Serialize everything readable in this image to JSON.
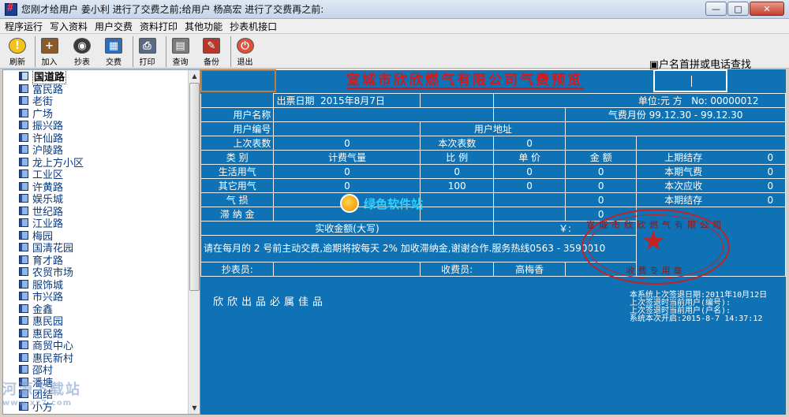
{
  "window": {
    "title": "您刚才给用户 姜小利 进行了交费之前;给用户 杨高宏 进行了交费再之前:",
    "buttons": [
      "—",
      "□",
      "✕"
    ]
  },
  "menu": [
    "程序运行",
    "写入资料",
    "用户交费",
    "资料打印",
    "其他功能",
    "抄表机接口"
  ],
  "toolbar": [
    {
      "label": "刷新",
      "icon": "lightbulb-icon",
      "color": "#f3c21b"
    },
    {
      "label": "加入",
      "icon": "add-record-icon",
      "color": "#8a5a2a"
    },
    {
      "label": "抄表",
      "icon": "meter-icon",
      "color": "#3a3a3a"
    },
    {
      "label": "交费",
      "icon": "calculator-icon",
      "color": "#2c6fb8"
    },
    {
      "label": "打印",
      "icon": "printer-icon",
      "color": "#596a85"
    },
    {
      "label": "查询",
      "icon": "query-icon",
      "color": "#7c7c7c"
    },
    {
      "label": "备份",
      "icon": "backup-icon",
      "color": "#b8372d"
    },
    {
      "label": "退出",
      "icon": "exit-icon",
      "color": "#e0513a"
    }
  ],
  "search_option": "▣户名首拼或电话查找",
  "tree": {
    "selected": "国道路",
    "items": [
      "国道路",
      "富民路",
      "老街",
      "广场",
      "振兴路",
      "许仙路",
      "沪陵路",
      "龙上方小区",
      "工业区",
      "许黄路",
      "娱乐城",
      "世纪路",
      "江业路",
      "梅园",
      "国清花园",
      "育才路",
      "农贸市场",
      "服饰城",
      "市兴路",
      "金鑫",
      "惠民园",
      "惠民路",
      "商贸中心",
      "惠民新村",
      "邵村",
      "潘塘",
      "团结",
      "小方"
    ]
  },
  "receipt": {
    "title": "宣城市欣欣燃气有限公司气费预览",
    "date_label": "出票日期",
    "date_value": "2015年8月7日",
    "unit_label": "单位:元 方",
    "no_label": "No:",
    "no_value": "00000012",
    "user_name_label": "用户名称",
    "period_label": "气费月份",
    "period_value": "99.12.30 - 99.12.30",
    "user_code_label": "用户编号",
    "address_label": "用户地址",
    "last_reading_label": "上次表数",
    "last_reading_value": "0",
    "this_reading_label": "本次表数",
    "this_reading_value": "0",
    "headers": [
      "类    别",
      "计费气量",
      "比    例",
      "单    价",
      "金    额"
    ],
    "rows": [
      {
        "type": "生活用气",
        "qty": "0",
        "ratio": "0",
        "price": "0",
        "amount": "0",
        "side_label": "上期结存",
        "side_value": "0"
      },
      {
        "type": "其它用气",
        "qty": "0",
        "ratio": "100",
        "price": "0",
        "amount": "0",
        "side_label": "本期气费",
        "side_value": "0"
      },
      {
        "type": "气    损",
        "qty": "0",
        "ratio": "",
        "price": "",
        "amount": "0",
        "side_label": "本次应收",
        "side_value": "0"
      },
      {
        "type": "滞 纳 金",
        "qty": "",
        "ratio": "",
        "price": "",
        "amount": "0",
        "side_label": "本期结存",
        "side_value": "0"
      }
    ],
    "amount_words_label": "实收金额(大写)",
    "currency_label": "￥:",
    "notice": "请在每月的 2 号前主动交费,逾期将按每天 2% 加收滞纳金,谢谢合作.服务热线0563 - 3590010",
    "reader_label": "抄表员:",
    "reader_value": "",
    "collector_label": "收费员:",
    "collector_value": "高梅香",
    "slogan": "欣欣出品必属佳品",
    "seal_top": "宣城市欣欣燃气有限公司",
    "seal_bottom": "收费专用章"
  },
  "system_info": [
    "本系统上次签退日期:2011年10月12日",
    "上次签退时当前用户(编号):",
    "上次签退时当前用户(户名):",
    "系统本次开启:2015-8-7 14:37:12"
  ],
  "watermarks": {
    "center": "绿色软件站",
    "corner": "河源下载站",
    "corner_url": "www.xz7.com"
  }
}
